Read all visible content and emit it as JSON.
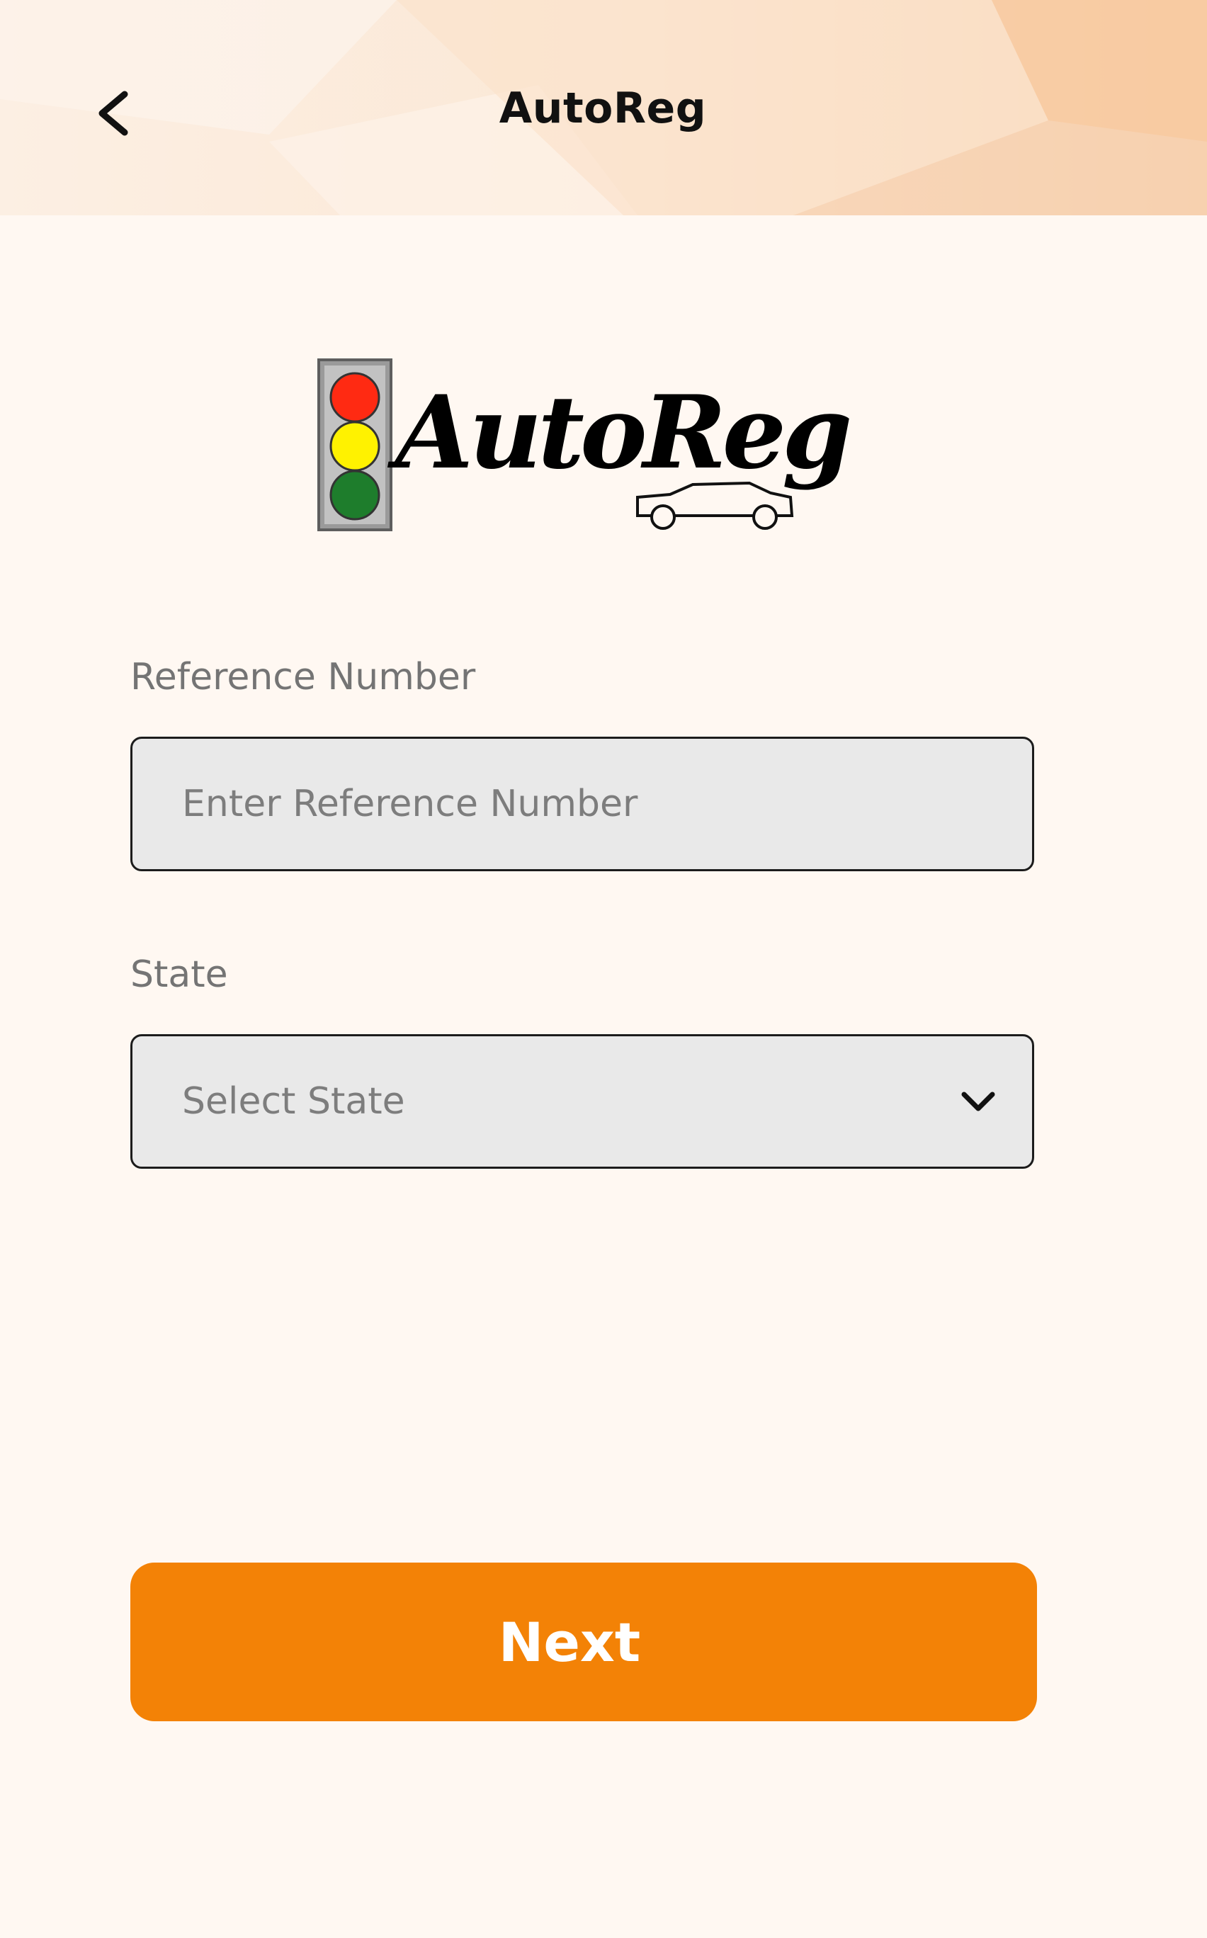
{
  "header": {
    "title": "AutoReg",
    "back_icon": "chevron-left-icon"
  },
  "logo": {
    "text": "AutoReg",
    "traffic_light_colors": [
      "#ff2a12",
      "#fff200",
      "#1e7d2c"
    ]
  },
  "form": {
    "reference": {
      "label": "Reference Number",
      "placeholder": "Enter Reference Number",
      "value": ""
    },
    "state": {
      "label": "State",
      "selected": "Select State",
      "icon": "chevron-down-icon"
    }
  },
  "actions": {
    "next_label": "Next"
  },
  "colors": {
    "accent": "#f38206",
    "background": "#fff8f2",
    "input_fill": "#e9e9e9"
  }
}
